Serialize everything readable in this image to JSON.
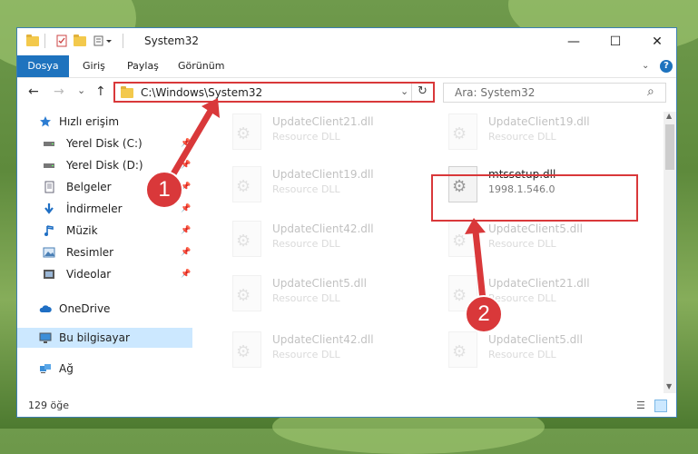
{
  "window": {
    "title": "System32",
    "controls": {
      "minimize": "—",
      "maximize": "☐",
      "close": "✕"
    }
  },
  "ribbon": {
    "tabs": [
      "Dosya",
      "Giriş",
      "Paylaş",
      "Görünüm"
    ],
    "help_icon": "?"
  },
  "navigation": {
    "back": "←",
    "forward": "→",
    "recent": "⌄",
    "up": "↑",
    "address": "C:\\Windows\\System32",
    "refresh": "↻",
    "search_placeholder": "Ara: System32",
    "search_icon": "⌕"
  },
  "sidebar": {
    "quick_access": "Hızlı erişim",
    "items": [
      {
        "label": "Yerel Disk (C:)",
        "icon": "drive-icon"
      },
      {
        "label": "Yerel Disk (D:)",
        "icon": "drive-icon"
      },
      {
        "label": "Belgeler",
        "icon": "documents-icon"
      },
      {
        "label": "İndirmeler",
        "icon": "download-icon"
      },
      {
        "label": "Müzik",
        "icon": "music-icon"
      },
      {
        "label": "Resimler",
        "icon": "pictures-icon"
      },
      {
        "label": "Videolar",
        "icon": "videos-icon"
      }
    ],
    "onedrive": "OneDrive",
    "this_pc": "Bu bilgisayar",
    "network": "Ağ"
  },
  "files": [
    {
      "name": "UpdateClient21.dll",
      "sub": "Resource DLL",
      "faded": true
    },
    {
      "name": "UpdateClient19.dll",
      "sub": "Resource DLL",
      "faded": true
    },
    {
      "name": "UpdateClient19.dll",
      "sub": "Resource DLL",
      "faded": true
    },
    {
      "name": "mtssetup.dll",
      "sub": "1998.1.546.0",
      "faded": false
    },
    {
      "name": "UpdateClient42.dll",
      "sub": "Resource DLL",
      "faded": true
    },
    {
      "name": "UpdateClient5.dll",
      "sub": "Resource DLL",
      "faded": true
    },
    {
      "name": "UpdateClient5.dll",
      "sub": "Resource DLL",
      "faded": true
    },
    {
      "name": "UpdateClient21.dll",
      "sub": "Resource DLL",
      "faded": true
    },
    {
      "name": "UpdateClient42.dll",
      "sub": "Resource DLL",
      "faded": true
    },
    {
      "name": "UpdateClient5.dll",
      "sub": "Resource DLL",
      "faded": true
    }
  ],
  "status": {
    "count": "129 öğe"
  },
  "callouts": {
    "one": "1",
    "two": "2"
  },
  "colors": {
    "accent": "#1e73be",
    "highlight": "#d9383a"
  }
}
